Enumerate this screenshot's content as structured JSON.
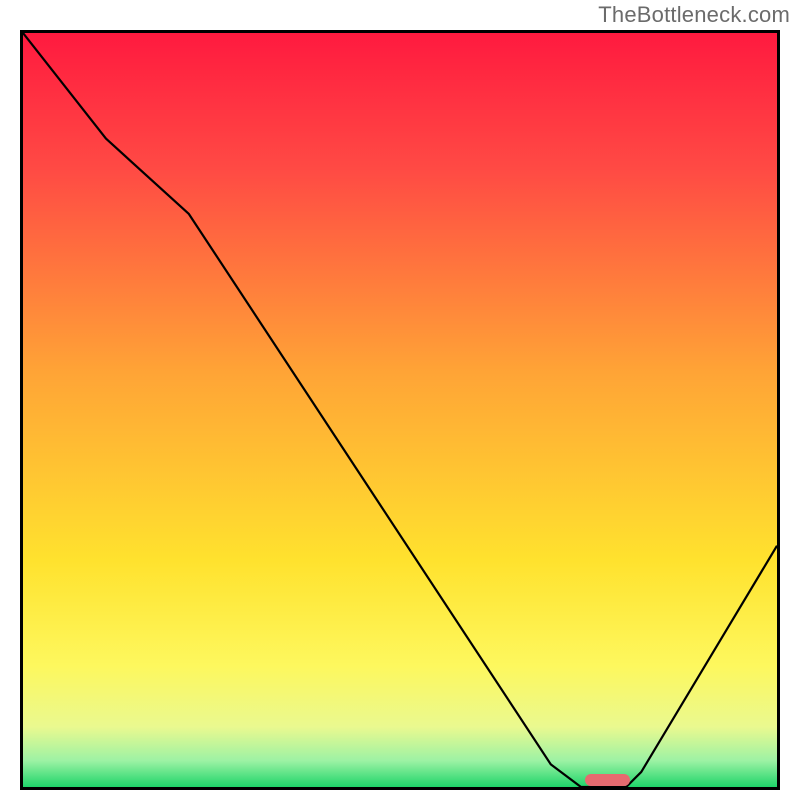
{
  "watermark": "TheBottleneck.com",
  "chart_data": {
    "type": "line",
    "title": "",
    "xlabel": "",
    "ylabel": "",
    "xlim": [
      0,
      100
    ],
    "ylim": [
      0,
      100
    ],
    "grid": false,
    "legend": false,
    "gradient_stops": [
      {
        "pct": 0,
        "color": "#ff1a3f"
      },
      {
        "pct": 18,
        "color": "#ff4a44"
      },
      {
        "pct": 45,
        "color": "#ffa436"
      },
      {
        "pct": 70,
        "color": "#ffe22e"
      },
      {
        "pct": 84,
        "color": "#fdf85e"
      },
      {
        "pct": 92,
        "color": "#eaf98f"
      },
      {
        "pct": 96.5,
        "color": "#9df2a4"
      },
      {
        "pct": 100,
        "color": "#1fd56a"
      }
    ],
    "series": [
      {
        "name": "bottleneck-curve",
        "x": [
          0,
          11,
          22,
          70,
          74,
          80,
          82,
          100
        ],
        "values": [
          100,
          86,
          76,
          3,
          0,
          0,
          2,
          32
        ]
      }
    ],
    "marker": {
      "name": "optimal-range",
      "x_start": 74.5,
      "x_end": 80.5,
      "y": 0.5,
      "color": "#e66a6f"
    }
  }
}
